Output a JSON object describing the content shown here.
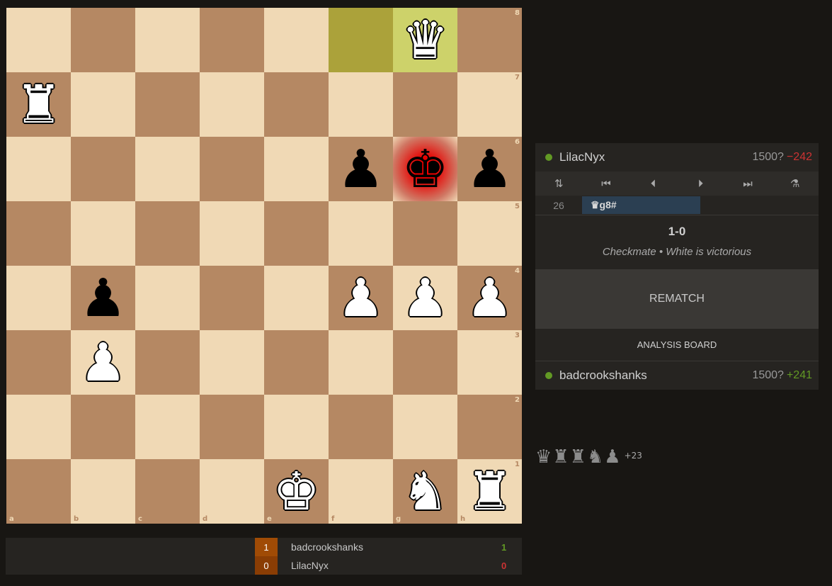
{
  "board": {
    "files": [
      "a",
      "b",
      "c",
      "d",
      "e",
      "f",
      "g",
      "h"
    ],
    "ranks": [
      "8",
      "7",
      "6",
      "5",
      "4",
      "3",
      "2",
      "1"
    ],
    "pieces": [
      {
        "square": "g8",
        "piece": "queen",
        "color": "white",
        "glyph": "♛"
      },
      {
        "square": "a7",
        "piece": "rook",
        "color": "white",
        "glyph": "♜"
      },
      {
        "square": "f6",
        "piece": "pawn",
        "color": "black",
        "glyph": "♟"
      },
      {
        "square": "g6",
        "piece": "king",
        "color": "black",
        "glyph": "♚"
      },
      {
        "square": "h6",
        "piece": "pawn",
        "color": "black",
        "glyph": "♟"
      },
      {
        "square": "b4",
        "piece": "pawn",
        "color": "black",
        "glyph": "♟"
      },
      {
        "square": "f4",
        "piece": "pawn",
        "color": "white",
        "glyph": "♟"
      },
      {
        "square": "g4",
        "piece": "pawn",
        "color": "white",
        "glyph": "♟"
      },
      {
        "square": "h4",
        "piece": "pawn",
        "color": "white",
        "glyph": "♟"
      },
      {
        "square": "b3",
        "piece": "pawn",
        "color": "white",
        "glyph": "♟"
      },
      {
        "square": "e1",
        "piece": "king",
        "color": "white",
        "glyph": "♚"
      },
      {
        "square": "g1",
        "piece": "knight",
        "color": "white",
        "glyph": "♞"
      },
      {
        "square": "h1",
        "piece": "rook",
        "color": "white",
        "glyph": "♜"
      }
    ],
    "last_move": [
      "f8",
      "g8"
    ],
    "check_square": "g6",
    "colors": {
      "light": "#f0d9b5",
      "dark": "#b58863"
    }
  },
  "top_player": {
    "name": "LilacNyx",
    "rating": "1500?",
    "diff": "−242",
    "diff_color": "#cc3333",
    "online": true
  },
  "bottom_player": {
    "name": "badcrookshanks",
    "rating": "1500?",
    "diff": "+241",
    "diff_color": "#629924",
    "online": true
  },
  "controls": [
    {
      "name": "flip-board-icon",
      "glyph": "⇅"
    },
    {
      "name": "first-move-icon",
      "glyph": "⏮"
    },
    {
      "name": "prev-move-icon",
      "glyph": "⏴"
    },
    {
      "name": "next-move-icon",
      "glyph": "⏵"
    },
    {
      "name": "last-move-icon",
      "glyph": "⏭"
    },
    {
      "name": "analysis-icon",
      "glyph": "⚗"
    }
  ],
  "moves": {
    "index": "26",
    "white_move": "♛g8#"
  },
  "result": {
    "score": "1-0",
    "status": "Checkmate • White is victorious"
  },
  "rematch_label": "REMATCH",
  "analysis_label": "ANALYSIS BOARD",
  "captured": {
    "pieces": [
      "♛",
      "♜",
      "♜",
      "♞",
      "♟"
    ],
    "advantage": "+23"
  },
  "crosstable": [
    {
      "score": "1",
      "name": "badcrookshanks",
      "points": "1",
      "points_color": "#629924"
    },
    {
      "score": "0",
      "name": "LilacNyx",
      "points": "0",
      "points_color": "#cc3333"
    }
  ]
}
